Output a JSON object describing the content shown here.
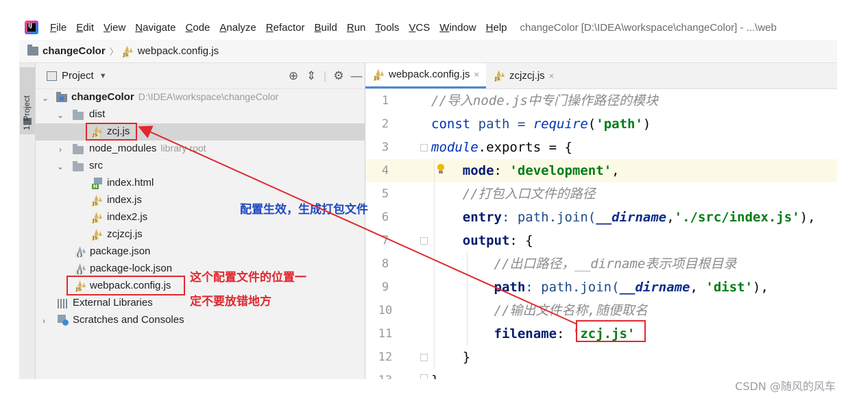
{
  "menubar": {
    "items": [
      "File",
      "Edit",
      "View",
      "Navigate",
      "Code",
      "Analyze",
      "Refactor",
      "Build",
      "Run",
      "Tools",
      "VCS",
      "Window",
      "Help"
    ],
    "window_title": "changeColor [D:\\IDEA\\workspace\\changeColor] - ...\\web"
  },
  "breadcrumb": {
    "project": "changeColor",
    "file": "webpack.config.js"
  },
  "tool_strip": {
    "project_tab": "1: Project"
  },
  "project_panel": {
    "title": "Project",
    "tree": {
      "root": {
        "label": "changeColor",
        "path": "D:\\IDEA\\workspace\\changeColor"
      },
      "dist": "dist",
      "dist_file": "zcj.js",
      "node_modules": {
        "label": "node_modules",
        "hint": "library root"
      },
      "src": "src",
      "src_files": [
        "index.html",
        "index.js",
        "index2.js",
        "zcjzcj.js"
      ],
      "package_json": "package.json",
      "package_lock": "package-lock.json",
      "webpack_config": "webpack.config.js",
      "external_libraries": "External Libraries",
      "scratches": "Scratches and Consoles"
    }
  },
  "editor": {
    "tabs": [
      {
        "label": "webpack.config.js",
        "active": true
      },
      {
        "label": "zcjzcj.js",
        "active": false
      }
    ],
    "line_numbers": [
      "1",
      "2",
      "3",
      "4",
      "5",
      "6",
      "7",
      "8",
      "9",
      "10",
      "11",
      "12",
      "13"
    ],
    "code": {
      "l1_comment": "//导入node.js中专门操作路径的模块",
      "l2_const": "const",
      "l2_var": " path = ",
      "l2_require": "require",
      "l2_open": "(",
      "l2_str": "'path'",
      "l2_close": ")",
      "l3_module": "module",
      "l3_rest": ".exports = {",
      "l4_key": "mode",
      "l4_colon": ": ",
      "l4_str": "'development'",
      "l4_comma": ",",
      "l5_comment": "//打包入口文件的路径",
      "l6_key": "entry",
      "l6_mid": ": path.join(",
      "l6_dir": "__dirname",
      "l6_comma": ",",
      "l6_str": "'./src/index.js'",
      "l6_end": "),",
      "l7_key": "output",
      "l7_rest": ": {",
      "l8_comment": "//出口路径，__dirname表示项目根目录",
      "l9_key": "path",
      "l9_mid": ": path.join(",
      "l9_dir": "__dirname",
      "l9_comma": ", ",
      "l9_str": "'dist'",
      "l9_end": "),",
      "l10_comment": "//输出文件名称,随便取名",
      "l11_key": "filename",
      "l11_colon": ": ",
      "l11_str": "'zcj.js'",
      "l12_brace": "}",
      "l13_brace": "}"
    }
  },
  "annotations": {
    "blue": "配置生效，生成打包文件",
    "red_line1": "这个配置文件的位置一",
    "red_line2": "定不要放错地方"
  },
  "watermark": "CSDN @随风的风车",
  "colors": {
    "annotation_red": "#e0282f",
    "annotation_blue": "#1f49c2",
    "keyword": "#0033b3",
    "string": "#067d17",
    "comment": "#8c8c8c"
  }
}
